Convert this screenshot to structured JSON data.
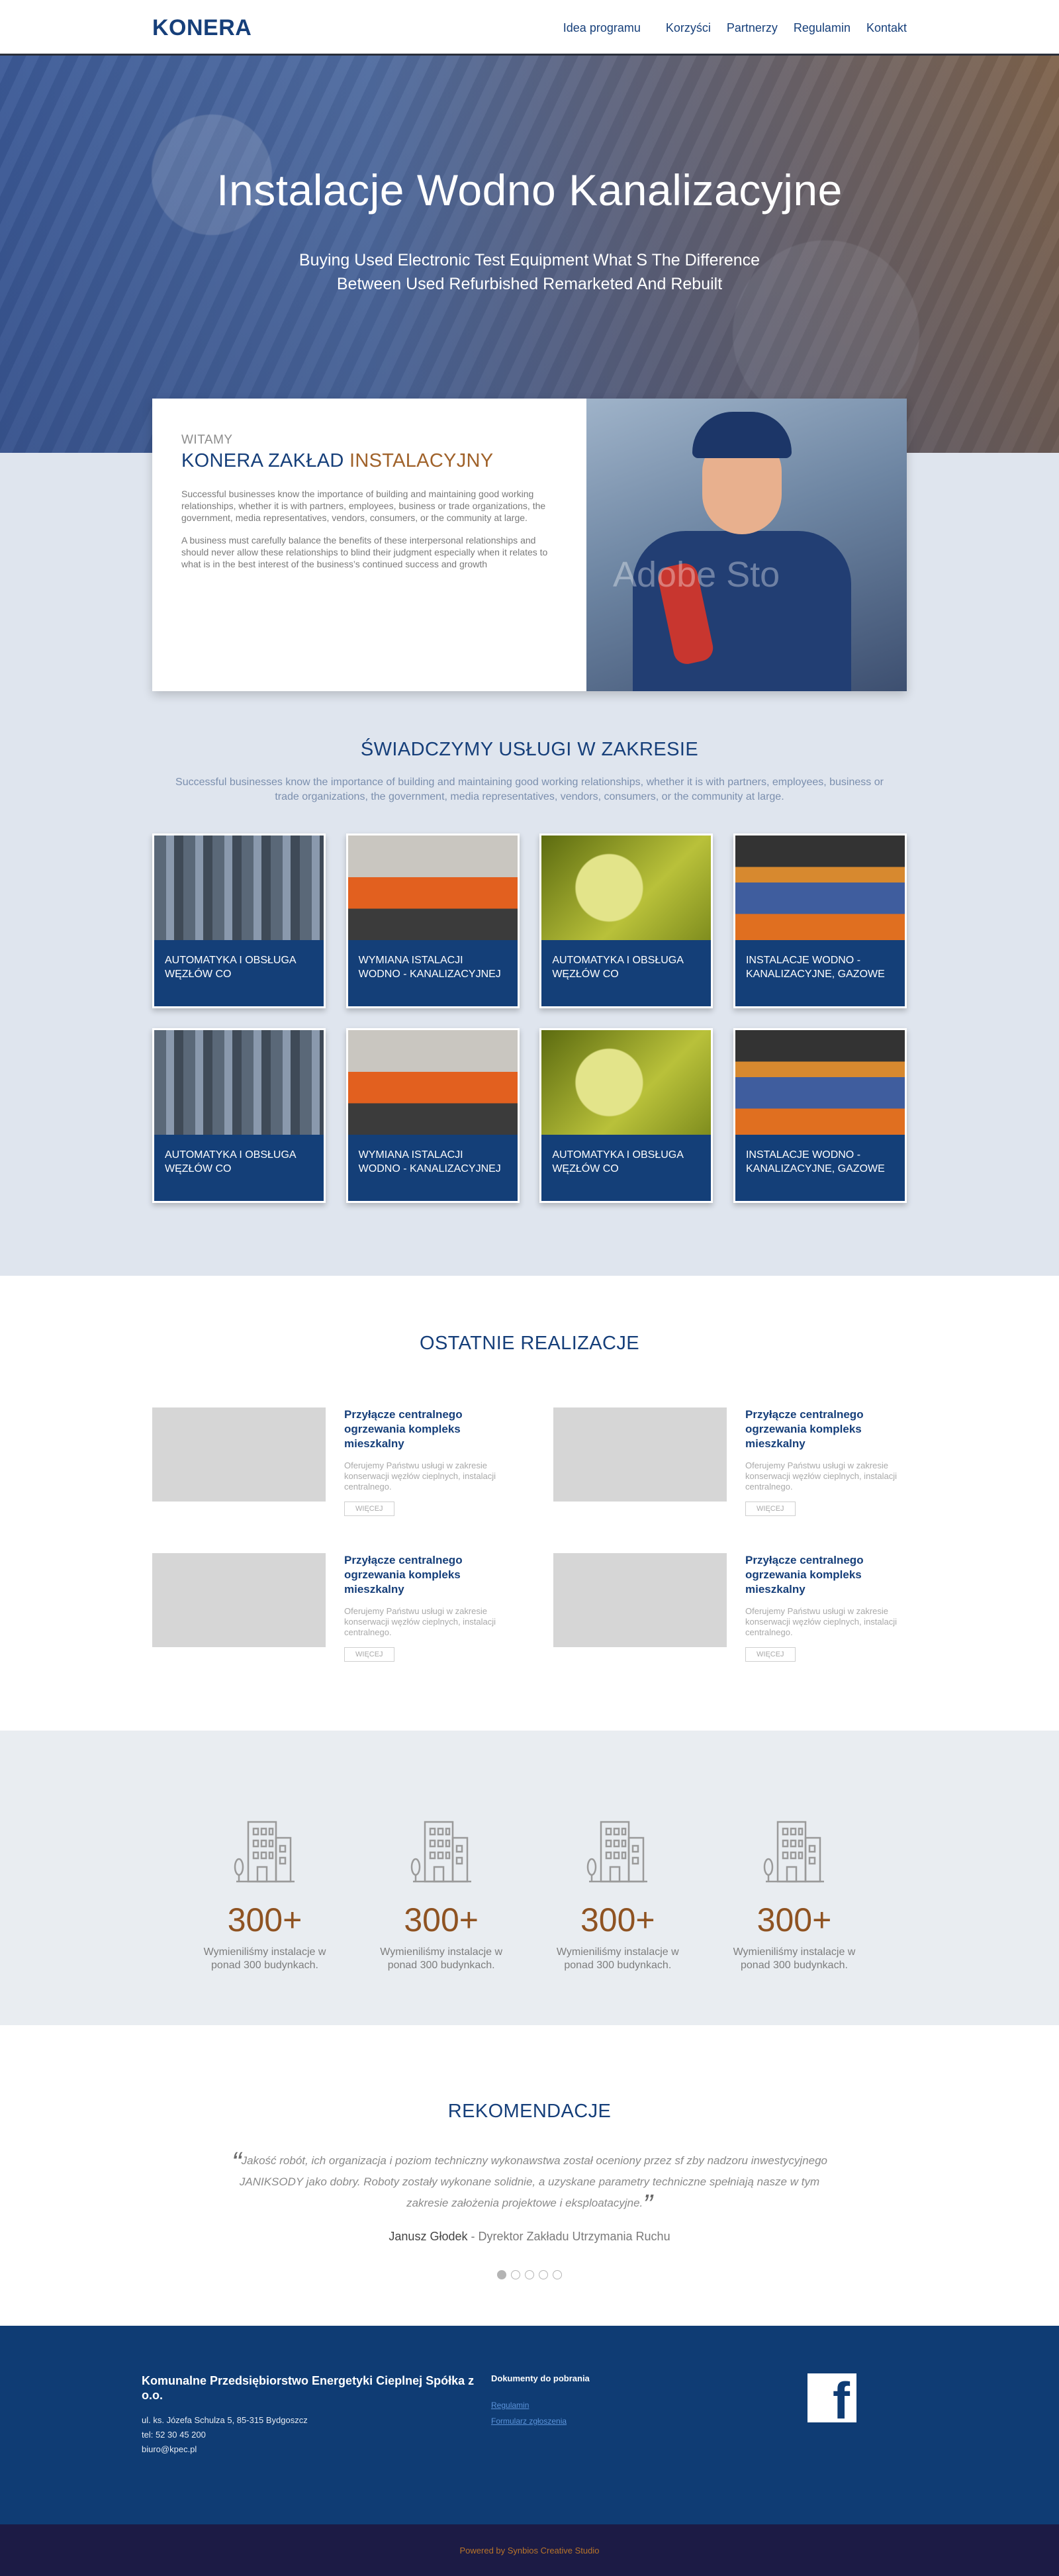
{
  "nav": {
    "logo": "KONERA",
    "items": [
      "Idea programu",
      "Korzyści",
      "Partnerzy",
      "Regulamin",
      "Kontakt"
    ]
  },
  "hero": {
    "title": "Instalacje Wodno Kanalizacyjne",
    "subtitle": "Buying Used Electronic Test Equipment What S The Difference Between Used Refurbished Remarketed And Rebuilt"
  },
  "welcome": {
    "pre": "WITAMY",
    "title_main": "KONERA ZAKŁAD ",
    "title_accent": "INSTALACYJNY",
    "p1": "Successful businesses know the importance of building and maintaining good working relationships, whether it is with partners, employees, business or trade organizations, the government, media representatives, vendors, consumers, or the community at large.",
    "p2": "A business must carefully balance the benefits of these interpersonal relationships and should never allow these relationships to blind their judgment especially when it relates to what is in the best interest of the business’s continued success and growth",
    "photo_watermark": "Adobe Sto"
  },
  "services": {
    "title": "ŚWIADCZYMY USŁUGI W ZAKRESIE",
    "intro": "Successful businesses know the importance of building and maintaining good working relationships, whether it is with partners, employees, business or trade organizations, the government, media representatives, vendors, consumers, or the community at large.",
    "cards": [
      {
        "label": "AUTOMATYKA I OBSŁUGA WĘZŁÓW CO"
      },
      {
        "label": "WYMIANA ISTALACJI WODNO - KANALIZACYJNEJ"
      },
      {
        "label": "AUTOMATYKA I OBSŁUGA WĘZŁÓW CO"
      },
      {
        "label": "INSTALACJE WODNO - KANALIZACYJNE, GAZOWE"
      },
      {
        "label": "AUTOMATYKA I OBSŁUGA WĘZŁÓW CO"
      },
      {
        "label": "WYMIANA ISTALACJI WODNO - KANALIZACYJNEJ"
      },
      {
        "label": "AUTOMATYKA I OBSŁUGA WĘZŁÓW CO"
      },
      {
        "label": "INSTALACJE WODNO - KANALIZACYJNE, GAZOWE"
      }
    ]
  },
  "realizacje": {
    "title": "OSTATNIE REALIZACJE",
    "items": [
      {
        "title": "Przyłącze centralnego ogrzewania kompleks mieszkalny",
        "desc": "Oferujemy Państwu usługi w zakresie konserwacji węzłów cieplnych, instalacji centralnego.",
        "more": "WIĘCEJ"
      },
      {
        "title": "Przyłącze centralnego ogrzewania kompleks mieszkalny",
        "desc": "Oferujemy Państwu usługi w zakresie konserwacji węzłów cieplnych, instalacji centralnego.",
        "more": "WIĘCEJ"
      },
      {
        "title": "Przyłącze centralnego ogrzewania kompleks mieszkalny",
        "desc": "Oferujemy Państwu usługi w zakresie konserwacji węzłów cieplnych, instalacji centralnego.",
        "more": "WIĘCEJ"
      },
      {
        "title": "Przyłącze centralnego ogrzewania kompleks mieszkalny",
        "desc": "Oferujemy Państwu usługi w zakresie konserwacji węzłów cieplnych, instalacji centralnego.",
        "more": "WIĘCEJ"
      }
    ]
  },
  "stats": [
    {
      "value": "300+",
      "label": "Wymieniliśmy instalacje w ponad 300 budynkach."
    },
    {
      "value": "300+",
      "label": "Wymieniliśmy instalacje w ponad 300 budynkach."
    },
    {
      "value": "300+",
      "label": "Wymieniliśmy instalacje w ponad 300 budynkach."
    },
    {
      "value": "300+",
      "label": "Wymieniliśmy instalacje w ponad 300 budynkach."
    }
  ],
  "reko": {
    "title": "REKOMENDACJE",
    "quote": "Jakość robót, ich organizacja i poziom techniczny wykonawstwa został oceniony przez sf zby nadzoru inwestycyjnego JANIKSODY jako dobry. Roboty zostały wykonane solidnie, a uzyskane parametry techniczne spełniają nasze w tym zakresie założenia projektowe i eksploatacyjne.",
    "author_name": "Janusz Głodek",
    "author_role": " - Dyrektor Zakładu Utrzymania Ruchu",
    "active_dot": 0,
    "dots": 5
  },
  "footer": {
    "company": "Komunalne Przedsiębiorstwo Energetyki Cieplnej Spółka z o.o.",
    "address": "ul. ks. Józefa Schulza 5, 85-315 Bydgoszcz",
    "phone": "tel: 52 30 45 200",
    "email": "biuro@kpec.pl",
    "docs_title": "Dokumenty do pobrania",
    "doc_links": [
      "Regulamin",
      "Formularz zgłoszenia"
    ],
    "social_icon": "facebook-icon",
    "powered": "Powered by Synbios Creative Studio"
  },
  "colors": {
    "brand": "#163f7a",
    "accent": "#a0622a",
    "footer": "#0f3c74",
    "bottom_bar": "#1c1b45"
  }
}
